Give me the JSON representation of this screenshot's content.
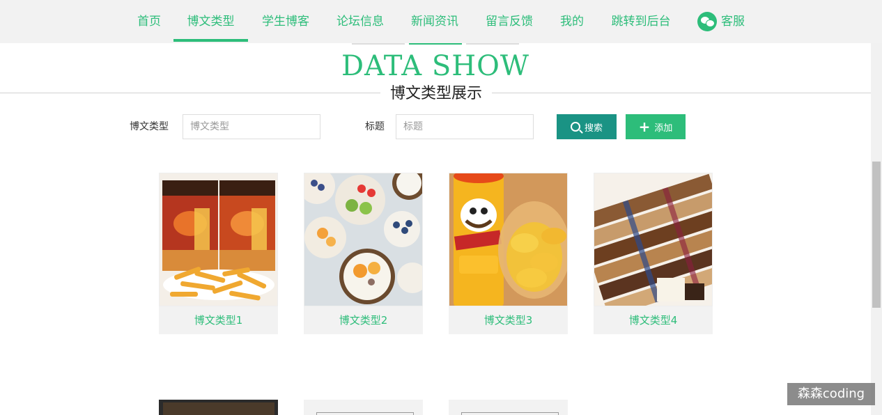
{
  "nav": {
    "items": [
      {
        "label": "首页"
      },
      {
        "label": "博文类型"
      },
      {
        "label": "学生博客"
      },
      {
        "label": "论坛信息"
      },
      {
        "label": "新闻资讯"
      },
      {
        "label": "留言反馈"
      },
      {
        "label": "我的"
      },
      {
        "label": "跳转到后台"
      }
    ],
    "service_label": "客服",
    "active_index": 1
  },
  "header": {
    "title_en": "DATA SHOW",
    "title_cn": "博文类型展示"
  },
  "search": {
    "type_label": "博文类型",
    "type_placeholder": "博文类型",
    "title_label": "标题",
    "title_placeholder": "标题",
    "search_button": "搜索",
    "add_button": "添加"
  },
  "cards": [
    {
      "title": "博文类型1"
    },
    {
      "title": "博文类型2"
    },
    {
      "title": "博文类型3"
    },
    {
      "title": "博文类型4"
    }
  ],
  "watermark": "森森coding",
  "colors": {
    "accent": "#2dbd7a",
    "search_button": "#1a9384"
  }
}
